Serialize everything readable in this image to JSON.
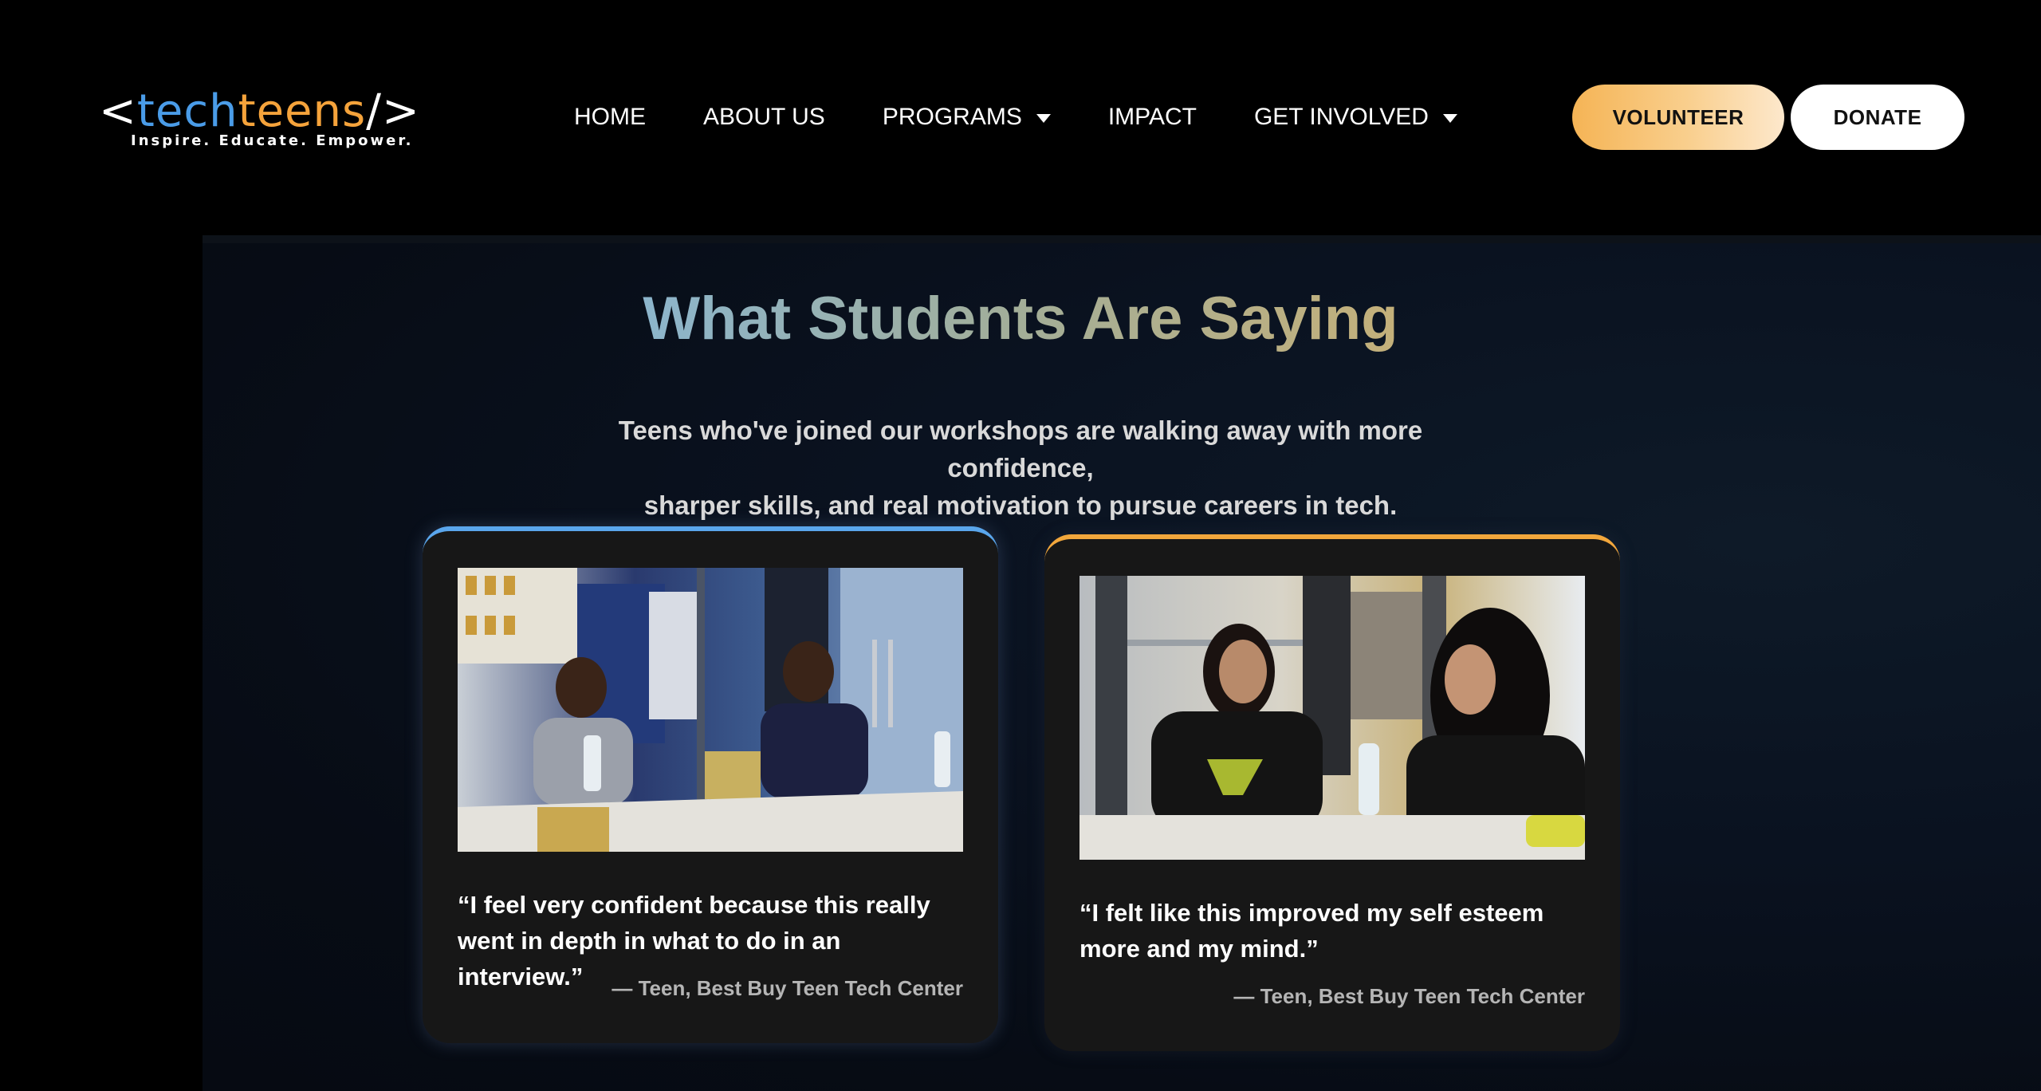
{
  "header": {
    "logo": {
      "open_bracket": "<",
      "tech": "tech",
      "teens": "teens",
      "close_bracket": "/>",
      "tagline": "Inspire. Educate. Empower."
    },
    "nav": [
      {
        "label": "HOME",
        "has_dropdown": false
      },
      {
        "label": "ABOUT US",
        "has_dropdown": false
      },
      {
        "label": "PROGRAMS",
        "has_dropdown": true
      },
      {
        "label": "IMPACT",
        "has_dropdown": false
      },
      {
        "label": "GET INVOLVED",
        "has_dropdown": true
      }
    ],
    "buttons": {
      "volunteer": "VOLUNTEER",
      "donate": "DONATE"
    }
  },
  "testimonials": {
    "title": "What Students Are Saying",
    "subtitle_line1": "Teens who've joined our workshops are walking away with more confidence,",
    "subtitle_line2": "sharper skills, and real motivation to pursue careers in tech.",
    "cards": [
      {
        "quote": "“I feel very confident because this really went in depth in what to do in an interview.”",
        "author": "— Teen, Best Buy Teen Tech Center",
        "accent": "#5aa6ec"
      },
      {
        "quote": "“I felt like this improved my self esteem more and my mind.”",
        "author": "— Teen, Best Buy Teen Tech Center",
        "accent": "#f2a73c"
      }
    ]
  },
  "colors": {
    "page_bg": "#000000",
    "logo_tech": "#4a9ce8",
    "logo_teens": "#f5a33b",
    "card_bg": "#171717",
    "title_gradient_start": "#8cb5cc",
    "title_gradient_end": "#c4b07a"
  },
  "icons": {
    "dropdown_caret": "caret-down-icon"
  }
}
